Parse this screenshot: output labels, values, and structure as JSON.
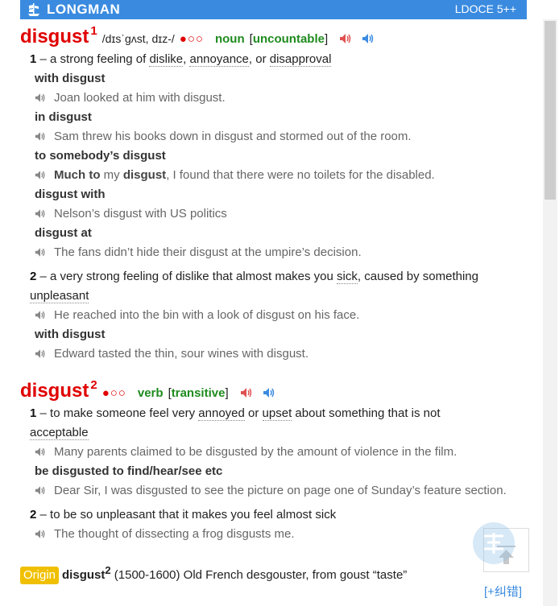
{
  "header": {
    "brand": "LONGMAN",
    "edition": "LDOCE 5++"
  },
  "entries": [
    {
      "headword": "disgust",
      "homnum": "1",
      "pron": "/dɪsˈɡʌst, dɪz-/",
      "freq": "●○○",
      "pos": "noun",
      "gram": "uncountable",
      "senses": [
        {
          "num": "1",
          "def_pre": "a strong feeling of ",
          "xref1": "dislike",
          "mid1": ", ",
          "xref2": "annoyance",
          "mid2": ", or ",
          "xref3": "disapproval"
        },
        {
          "num": "2",
          "def_pre": "a very strong feeling of dislike that almost makes you ",
          "xref1": "sick",
          "def_post": ", caused by something",
          "xref2": "unpleasant"
        }
      ],
      "lines": {
        "c1": "with disgust",
        "e1": "Joan looked at him with disgust.",
        "c2": "in disgust",
        "e2": "Sam threw his books down in disgust and stormed out of the room.",
        "c3": "to somebody’s disgust",
        "e3_b1": "Much to",
        "e3_t1": " my ",
        "e3_b2": "disgust",
        "e3_t2": ", I found that there were no toilets for the disabled.",
        "c4": "disgust with",
        "e4": "Nelson’s disgust with US politics",
        "c5": "disgust at",
        "e5": "The fans didn’t hide their disgust at the umpire’s decision.",
        "e6": "He reached into the bin with a look of disgust on his face.",
        "c7": "with disgust",
        "e7": "Edward tasted the thin, sour wines with disgust."
      }
    },
    {
      "headword": "disgust",
      "homnum": "2",
      "freq": "●○○",
      "pos": "verb",
      "gram": "transitive",
      "senses": [
        {
          "num": "1",
          "def_pre": "to make someone feel very ",
          "xref1": "annoyed",
          "mid1": " or ",
          "xref2": "upset",
          "def_post": " about something that is not",
          "xref3": "acceptable"
        },
        {
          "num": "2",
          "def": "to be so unpleasant that it makes you feel almost sick"
        }
      ],
      "lines": {
        "e1": "Many parents claimed to be disgusted by the amount of violence in the film.",
        "c2": "be disgusted to find/hear/see etc",
        "e2": "Dear Sir, I was disgusted to see the picture on page one of Sunday’s feature section.",
        "e3": "The thought of dissecting a frog disgusts me."
      }
    }
  ],
  "origin": {
    "tag": "Origin",
    "headword": "disgust",
    "homnum": "2",
    "text": "(1500-1600) Old French desgouster, from goust “taste”"
  },
  "fix_link": "[+纠错]",
  "icons": {
    "speaker_red": "#e05050",
    "speaker_blue": "#3a8be0",
    "speaker_grey": "#888888"
  }
}
